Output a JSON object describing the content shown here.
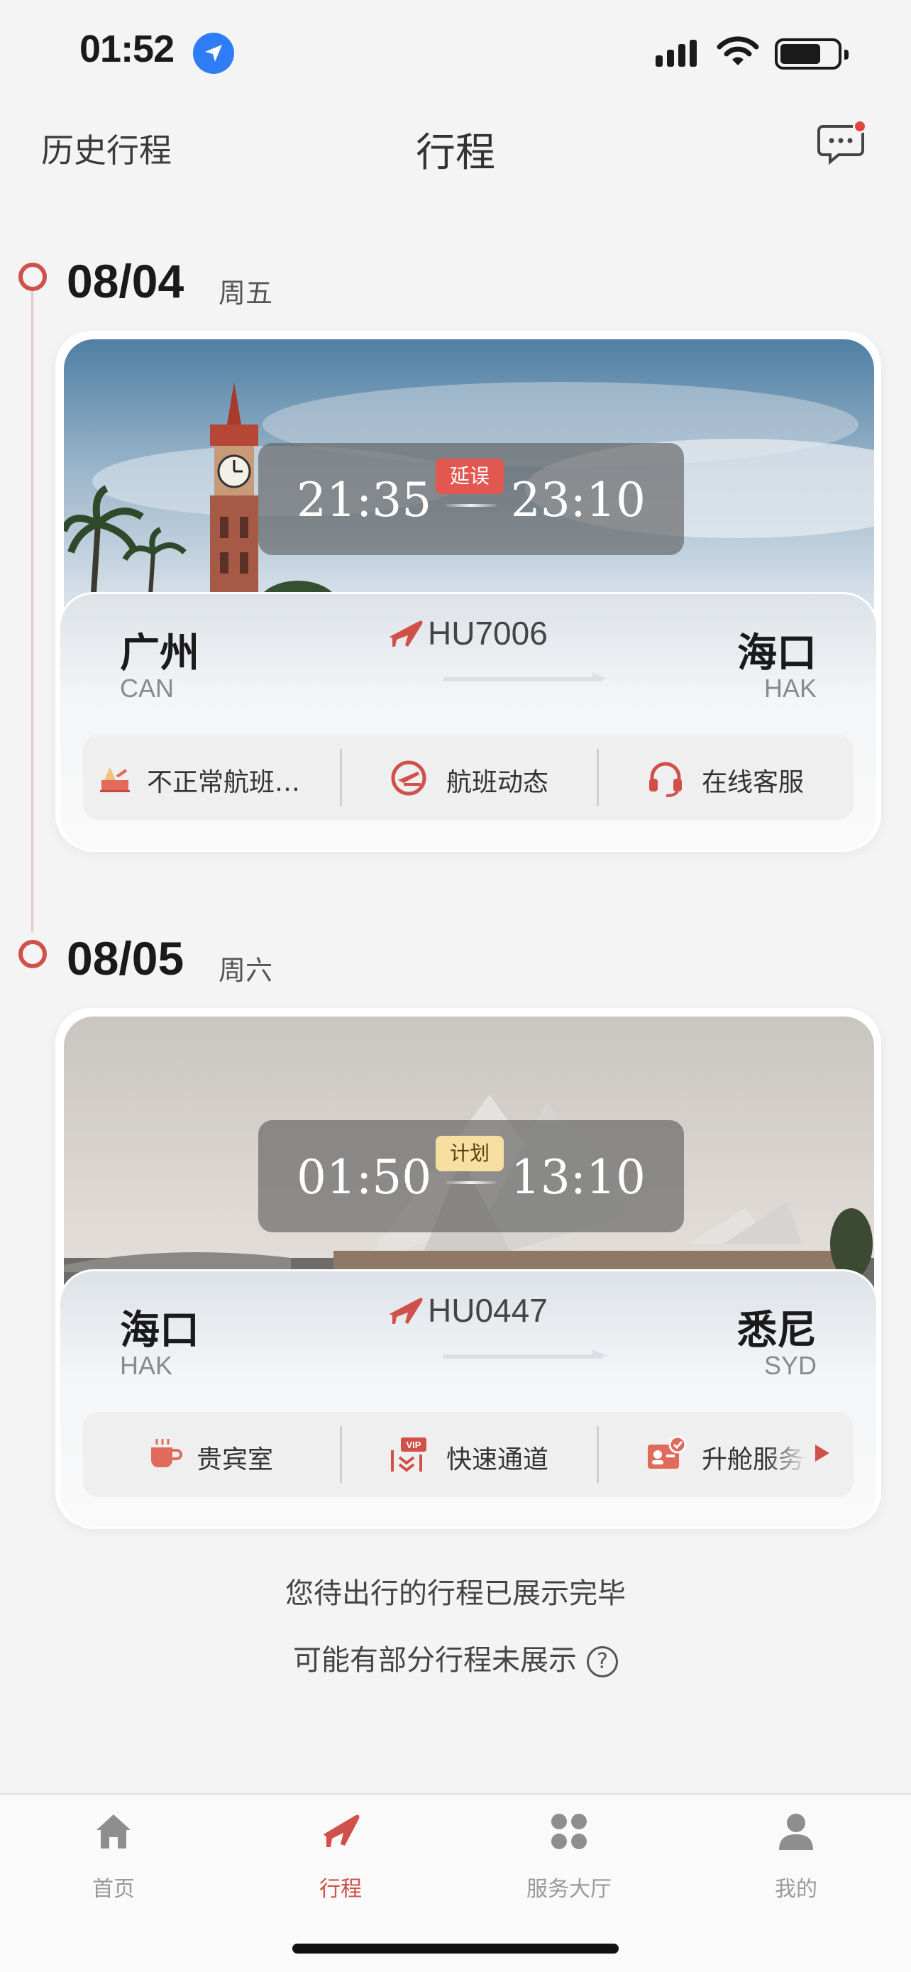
{
  "status_bar": {
    "time": "01:52"
  },
  "nav": {
    "left_label": "历史行程",
    "title": "行程"
  },
  "trips": [
    {
      "date": "08/04",
      "weekday": "周五",
      "dep_time": "21:35",
      "arr_time": "23:10",
      "status": "延误",
      "flight_no": "HU7006",
      "from_city": "广州",
      "from_code": "CAN",
      "to_city": "海口",
      "to_code": "HAK",
      "actions": [
        "不正常航班…",
        "航班动态",
        "在线客服"
      ]
    },
    {
      "date": "08/05",
      "weekday": "周六",
      "dep_time": "01:50",
      "arr_time": "13:10",
      "status": "计划",
      "flight_no": "HU0447",
      "from_city": "海口",
      "from_code": "HAK",
      "to_city": "悉尼",
      "to_code": "SYD",
      "actions": [
        "贵宾室",
        "快速通道",
        "升舱服务"
      ]
    }
  ],
  "footer": {
    "line1": "您待出行的行程已展示完毕",
    "line2": "可能有部分行程未展示",
    "help_icon": "?"
  },
  "tabs": [
    {
      "label": "首页",
      "icon": "home-icon"
    },
    {
      "label": "行程",
      "icon": "plane-icon"
    },
    {
      "label": "服务大厅",
      "icon": "grid-icon"
    },
    {
      "label": "我的",
      "icon": "person-icon"
    }
  ],
  "colors": {
    "accent": "#d0504a",
    "delay": "#e2574f",
    "plan": "#f6dfa0"
  }
}
